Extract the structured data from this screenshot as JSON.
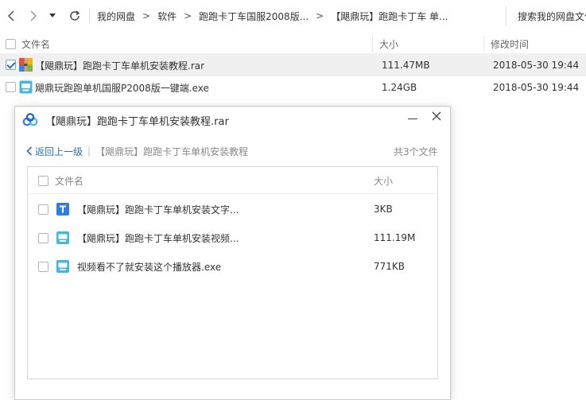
{
  "navbar": {
    "breadcrumb": [
      "我的网盘",
      "软件",
      "跑跑卡丁车国服2008版...",
      "【飓鼎玩】跑跑卡丁车 单..."
    ],
    "search_placeholder": "搜索我的网盘文件"
  },
  "list": {
    "columns": {
      "name": "文件名",
      "size": "大小",
      "modified": "修改时间"
    },
    "files": [
      {
        "name": "【飓鼎玩】跑跑卡丁车单机安装教程.rar",
        "size": "111.47MB",
        "modified": "2018-05-30 19:44",
        "icon": "rar-archive-icon",
        "selected": true
      },
      {
        "name": "飓鼎玩跑跑单机国服P2008版一键端.exe",
        "size": "1.24GB",
        "modified": "2018-05-30 19:44",
        "icon": "exe-file-icon",
        "selected": false
      }
    ]
  },
  "dialog": {
    "title": "【飓鼎玩】跑跑卡丁车单机安装教程.rar",
    "back_label": "返回上一级",
    "current_path": "【飓鼎玩】跑跑卡丁车单机安装教程",
    "count_label": "共3个文件",
    "columns": {
      "name": "文件名",
      "size": "大小"
    },
    "files": [
      {
        "name": "【飓鼎玩】跑跑卡丁车单机安装文字...",
        "size": "3KB",
        "icon": "text-document-icon"
      },
      {
        "name": "【飓鼎玩】跑跑卡丁车单机安装视频...",
        "size": "111.19M",
        "icon": "exe-file-icon"
      },
      {
        "name": "视频看不了就安装这个播放器.exe",
        "size": "771KB",
        "icon": "exe-file-icon"
      }
    ]
  },
  "colors": {
    "accent": "#2f6fbf",
    "icon_blue": "#2e7ce6",
    "exe_teal": "#3fb8e8"
  }
}
